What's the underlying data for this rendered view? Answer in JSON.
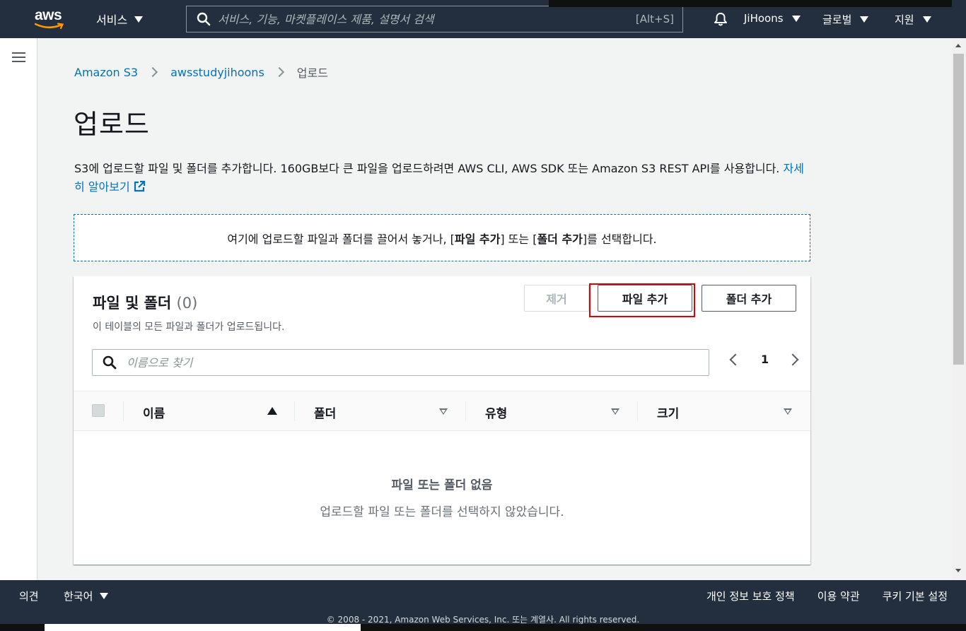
{
  "topnav": {
    "logo_text": "aws",
    "services_label": "서비스",
    "search_placeholder": "서비스, 기능, 마켓플레이스 제품, 설명서 검색",
    "search_shortcut": "[Alt+S]",
    "user_label": "JiHoons",
    "region_label": "글로벌",
    "support_label": "지원"
  },
  "breadcrumb": {
    "items": [
      "Amazon S3",
      "awsstudyjihoons",
      "업로드"
    ]
  },
  "page": {
    "title": "업로드",
    "description": "S3에 업로드할 파일 및 폴더를 추가합니다. 160GB보다 큰 파일을 업로드하려면 AWS CLI, AWS SDK 또는 Amazon S3 REST API를 사용합니다.",
    "learn_more": "자세히 알아보기"
  },
  "dropzone": {
    "text_before": "여기에 업로드할 파일과 폴더를 끌어서 놓거나, [",
    "add_files": "파일 추가",
    "text_middle": "] 또는 [",
    "add_folder": "폴더 추가",
    "text_after": "]를 선택합니다."
  },
  "files_panel": {
    "title": "파일 및 폴더",
    "count": "(0)",
    "subtitle": "이 테이블의 모든 파일과 폴더가 업로드됩니다.",
    "remove_label": "제거",
    "add_files_label": "파일 추가",
    "add_folder_label": "폴더 추가",
    "filter_placeholder": "이름으로 찾기",
    "page_number": "1",
    "columns": [
      "이름",
      "폴더",
      "유형",
      "크기"
    ],
    "empty_title": "파일 또는 폴더 없음",
    "empty_subtitle": "업로드할 파일 또는 폴더를 선택하지 않았습니다."
  },
  "footer": {
    "feedback": "의견",
    "language": "한국어",
    "links": [
      "개인 정보 보호 정책",
      "이용 약관",
      "쿠키 기본 설정"
    ],
    "copyright": "© 2008 - 2021, Amazon Web Services, Inc. 또는 계열사. All rights reserved."
  },
  "colors": {
    "nav_bg": "#232f3e",
    "link": "#0073bb",
    "highlight": "#e00000",
    "page_bg": "#f2f3f3"
  }
}
